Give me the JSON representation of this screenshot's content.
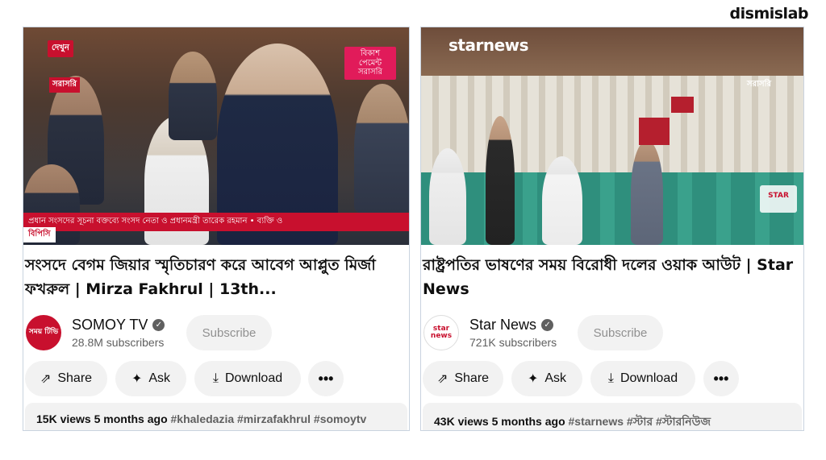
{
  "brand": "dismislab",
  "cards": [
    {
      "thumbnail": {
        "logo": "দেখুন",
        "badge": "সরাসরি",
        "tag": "বিকাশ পেমেন্ট সরাসরি",
        "ticker": "প্রধান সংসদের সূচনা বক্তব্যে সংসদ নেতা ও প্রধানমন্ত্রী তারেক রহমান  •  ব্যক্তি ও",
        "ticker_source": "বিপিসি"
      },
      "title": "সংসদে বেগম জিয়ার স্মৃতিচারণ করে আবেগ আপ্লুত মির্জা ফখরুল | Mirza Fakhrul | 13th...",
      "channel": {
        "avatar": "সময় টিভি",
        "name": "SOMOY TV",
        "subscribers": "28.8M subscribers"
      },
      "subscribe": "Subscribe",
      "actions": {
        "share": "Share",
        "ask": "Ask",
        "download": "Download",
        "more": "•••"
      },
      "description": {
        "views": "15K views",
        "age": "5 months ago",
        "tags": "#khaledazia #mirzafakhrul #somoytv"
      }
    },
    {
      "thumbnail": {
        "logo": "starnews",
        "badge": "সরাসরি",
        "corner": "STAR"
      },
      "title": "রাষ্ট্রপতির ভাষণের সময় বিরোধী দলের ওয়াক আউট | Star News",
      "channel": {
        "avatar": "star news",
        "name": "Star News",
        "subscribers": "721K subscribers"
      },
      "subscribe": "Subscribe",
      "actions": {
        "share": "Share",
        "ask": "Ask",
        "download": "Download",
        "more": "•••"
      },
      "description": {
        "views": "43K views",
        "age": "5 months ago",
        "tags": "#starnews #স্টার #স্টারনিউজ"
      }
    }
  ]
}
